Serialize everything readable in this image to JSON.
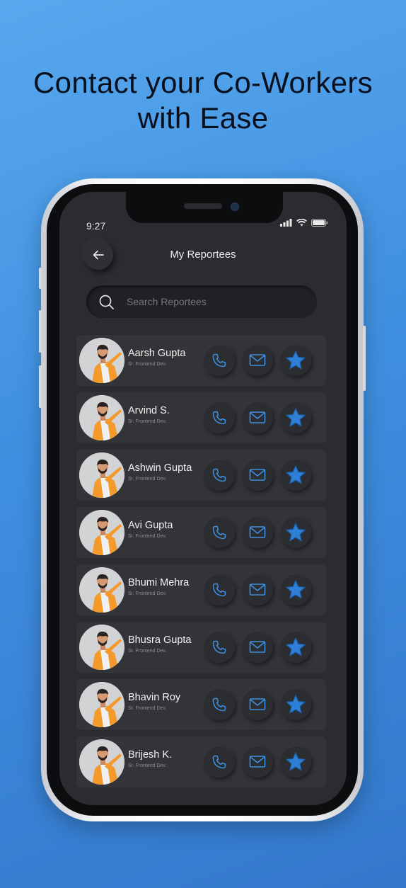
{
  "headline": {
    "line1": "Contact your Co-Workers",
    "line2": "with Ease"
  },
  "status_bar": {
    "time": "9:27",
    "icons": [
      "signal-icon",
      "wifi-icon",
      "battery-icon"
    ]
  },
  "header": {
    "title": "My Reportees",
    "back_icon": "arrow-left-icon"
  },
  "search": {
    "placeholder": "Search Reportees",
    "icon": "search-icon"
  },
  "contacts": [
    {
      "name": "Aarsh Gupta",
      "role": "Sr. Frontend Dev."
    },
    {
      "name": "Arvind S.",
      "role": "Sr. Frontend Dev."
    },
    {
      "name": "Ashwin Gupta",
      "role": "Sr. Frontend Dev."
    },
    {
      "name": "Avi Gupta",
      "role": "Sr. Frontend Dev."
    },
    {
      "name": "Bhumi Mehra",
      "role": "Sr. Frontend Dev."
    },
    {
      "name": "Bhusra Gupta",
      "role": "Sr. Frontend Dev."
    },
    {
      "name": "Bhavin Roy",
      "role": "Sr. Frontend Dev."
    },
    {
      "name": "Brijesh K.",
      "role": "Sr. Frontend Dev."
    }
  ],
  "colors": {
    "accent": "#3d8fe0",
    "background_gradient": [
      "#58a8ee",
      "#3478cc"
    ],
    "screen_bg": "#2b2c30",
    "card_bg": "#333438"
  }
}
